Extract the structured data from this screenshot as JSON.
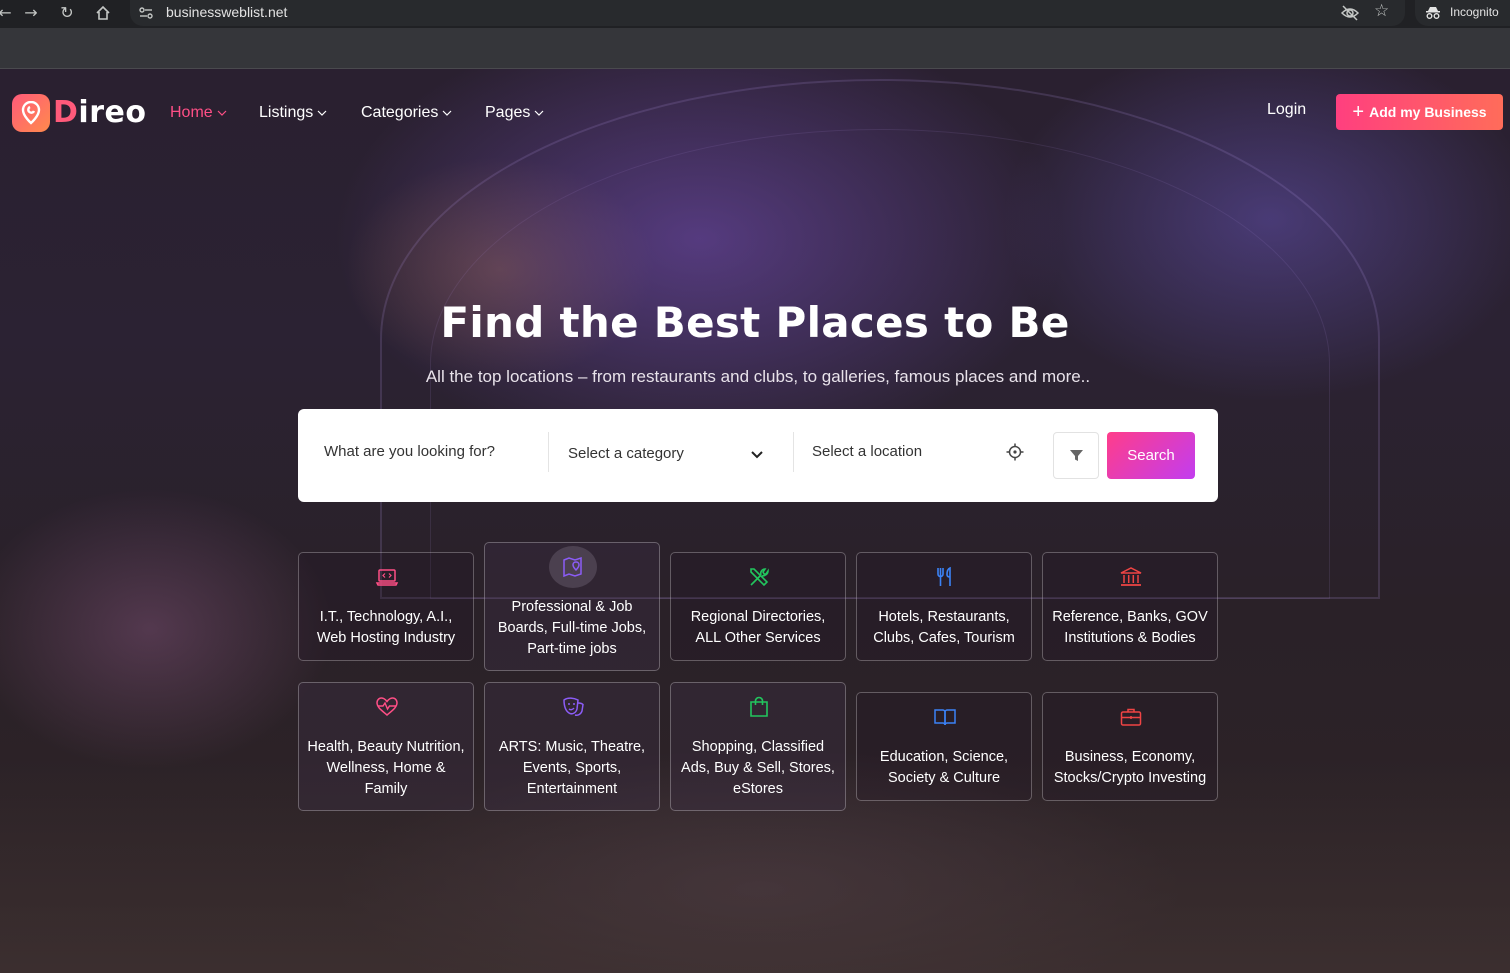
{
  "browser": {
    "url": "businessweblist.net",
    "incognito_label": "Incognito",
    "icons": [
      "back-arrow-icon",
      "forward-arrow-icon",
      "reload-icon",
      "home-icon",
      "site-info-icon",
      "eye-off-icon",
      "bookmark-star-icon",
      "incognito-icon"
    ]
  },
  "header": {
    "logo_text": "ireo",
    "logo_initial": "D",
    "nav": [
      {
        "label": "Home",
        "active": true
      },
      {
        "label": "Listings",
        "active": false
      },
      {
        "label": "Categories",
        "active": false
      },
      {
        "label": "Pages",
        "active": false
      }
    ],
    "login_label": "Login",
    "add_business_label": "Add my Business"
  },
  "hero": {
    "title": "Find the Best Places to Be",
    "subtitle": "All the top locations – from restaurants and clubs, to galleries, famous places and more.."
  },
  "search": {
    "what_placeholder": "What are you looking for?",
    "category_placeholder": "Select a category",
    "location_placeholder": "Select a location",
    "button_label": "Search"
  },
  "categories": [
    {
      "label": "I.T., Technology, A.I., Web Hosting Industry",
      "icon": "laptop-code-icon",
      "color": "#ff4f86"
    },
    {
      "label": "Professional & Job Boards, Full-time Jobs, Part-time jobs",
      "icon": "map-pin-icon",
      "color": "#8b5cf6"
    },
    {
      "label": "Regional Directories, ALL Other Services",
      "icon": "tools-icon",
      "color": "#22c55e"
    },
    {
      "label": "Hotels, Restaurants, Clubs, Cafes, Tourism",
      "icon": "fork-knife-icon",
      "color": "#3b82f6"
    },
    {
      "label": "Reference, Banks, GOV Institutions & Bodies",
      "icon": "bank-icon",
      "color": "#ef4444"
    },
    {
      "label": "Health, Beauty Nutrition, Wellness, Home & Family",
      "icon": "heart-pulse-icon",
      "color": "#ff4f86"
    },
    {
      "label": "ARTS: Music, Theatre, Events, Sports, Entertainment",
      "icon": "theatre-mask-icon",
      "color": "#8b5cf6"
    },
    {
      "label": "Shopping, Classified Ads, Buy & Sell, Stores, eStores",
      "icon": "shopping-bag-icon",
      "color": "#22c55e"
    },
    {
      "label": "Education, Science, Society & Culture",
      "icon": "open-book-icon",
      "color": "#3b82f6"
    },
    {
      "label": "Business, Economy, Stocks/Crypto Investing",
      "icon": "briefcase-icon",
      "color": "#ef4444"
    }
  ],
  "colors": {
    "accent": "#ff4f86",
    "search_gradient": [
      "#ff3d8a",
      "#c23df0"
    ],
    "add_button_gradient": [
      "#ff3f7f",
      "#ff6c5a"
    ]
  }
}
